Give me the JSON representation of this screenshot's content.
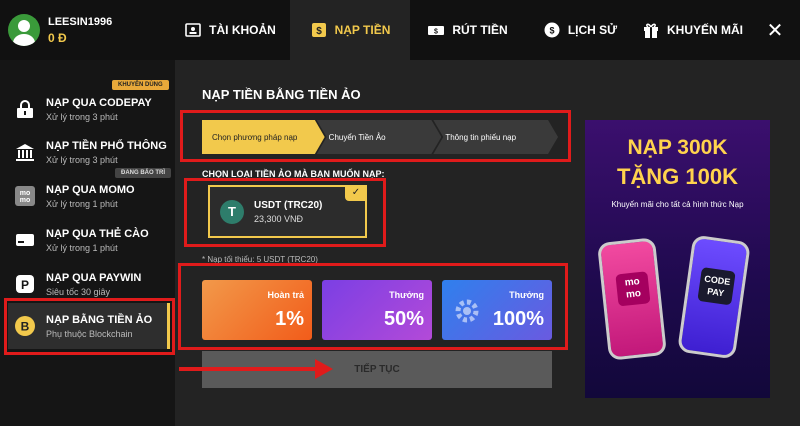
{
  "user": {
    "name": "LEESIN1996",
    "balance": "0 Đ"
  },
  "nav": [
    {
      "label": "TÀI KHOẢN",
      "icon": "account-icon"
    },
    {
      "label": "NẠP TIỀN",
      "icon": "deposit-icon",
      "active": true
    },
    {
      "label": "RÚT TIỀN",
      "icon": "withdraw-icon"
    },
    {
      "label": "LỊCH SỬ",
      "icon": "history-icon"
    },
    {
      "label": "KHUYẾN MÃI",
      "icon": "gift-icon"
    }
  ],
  "close_label": "✕",
  "sidebar": {
    "items": [
      {
        "title": "NẠP QUA CODEPAY",
        "sub": "Xử lý trong 3 phút",
        "tag": "KHUYÊN DÙNG",
        "icon": "codepay-icon"
      },
      {
        "title": "NẠP TIỀN PHỔ THÔNG",
        "sub": "Xử lý trong 3 phút",
        "icon": "bank-icon"
      },
      {
        "title": "NẠP QUA MOMO",
        "sub": "Xử lý trong 1 phút",
        "tag": "ĐANG BẢO TRÌ",
        "icon": "momo-icon"
      },
      {
        "title": "NẠP QUA THẺ CÀO",
        "sub": "Xử lý trong 1 phút",
        "icon": "card-icon"
      },
      {
        "title": "NẠP QUA PAYWIN",
        "sub": "Siêu tốc 30 giây",
        "icon": "paywin-icon"
      },
      {
        "title": "NẠP BẰNG TIỀN ẢO",
        "sub": "Phụ thuộc Blockchain",
        "icon": "bitcoin-icon",
        "active": true
      }
    ]
  },
  "main": {
    "title": "NẠP TIỀN BẰNG TIỀN ẢO",
    "steps": [
      "Chọn phương pháp nạp",
      "Chuyển Tiền Ảo",
      "Thông tin phiếu nạp"
    ],
    "choose_label": "CHỌN LOẠI TIỀN ẢO MÀ BẠN MUỐN NẠP:",
    "coin": {
      "name": "USDT (TRC20)",
      "rate": "23,300 VNĐ",
      "symbol": "T",
      "check": "✓"
    },
    "min_note": "* Nạp tối thiểu: 5 USDT (TRC20)",
    "bonuses": [
      {
        "label": "Hoàn trả",
        "value": "1%"
      },
      {
        "label": "Thưởng",
        "value": "50%"
      },
      {
        "label": "Thưởng",
        "value": "100%"
      }
    ],
    "continue_label": "TIẾP TỤC"
  },
  "banner": {
    "title_line1": "NẠP 300K",
    "title_line2": "TẶNG 100K",
    "subtitle": "Khuyến mãi cho tất cả hình thức Nạp",
    "momo_text": "mo mo",
    "codepay_text": "CODE PAY"
  },
  "colors": {
    "accent": "#f2c94c",
    "highlight": "#e01b1b"
  }
}
